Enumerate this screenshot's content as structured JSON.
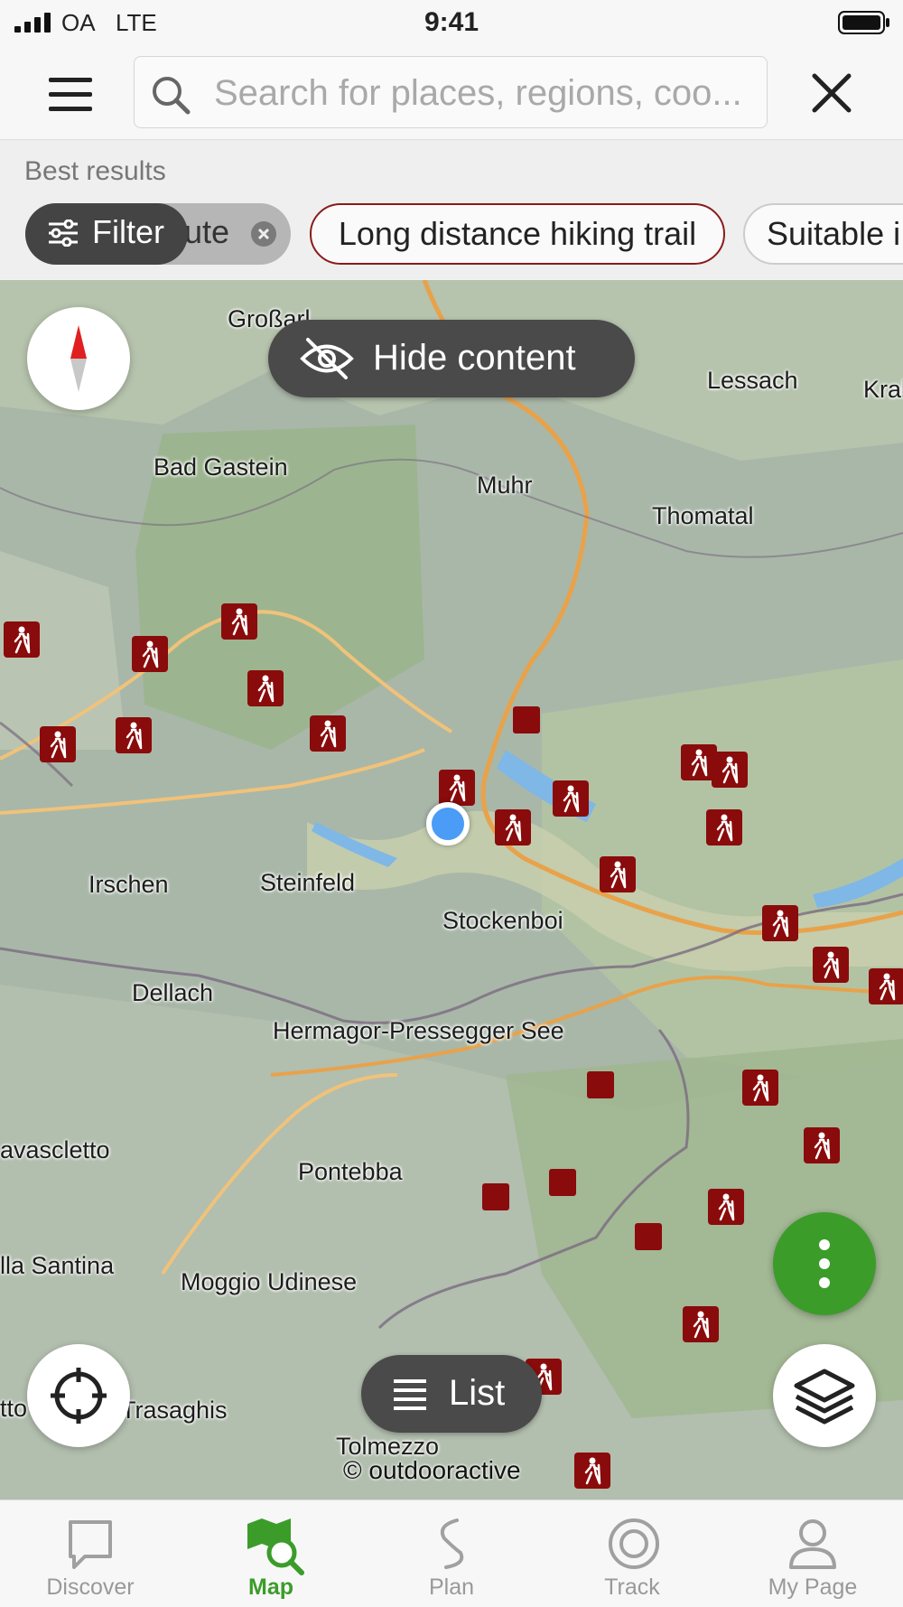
{
  "status_bar": {
    "carrier": "OA",
    "network": "LTE",
    "time": "9:41"
  },
  "search": {
    "placeholder": "Search for places, regions, coo..."
  },
  "results": {
    "title": "Best results",
    "chips": {
      "route_tail": "ute",
      "filter": "Filter",
      "long_distance": "Long distance hiking trail",
      "suitable": "Suitable i"
    }
  },
  "map": {
    "hide_content": "Hide content",
    "list": "List",
    "attribution": "© outdooractive",
    "places": {
      "grossarl": "Großarl",
      "lessach": "Lessach",
      "krak": "Krak",
      "bad_gastein": "Bad Gastein",
      "muhr": "Muhr",
      "thomatal": "Thomatal",
      "irschen": "Irschen",
      "steinfeld": "Steinfeld",
      "stockenboi": "Stockenboi",
      "dellach": "Dellach",
      "hermagor": "Hermagor-Pressegger See",
      "ravascletto": "avascletto",
      "pontebba": "Pontebba",
      "sella_santina": "lla Santina",
      "moggio": "Moggio Udinese",
      "otto": "tto",
      "trasaghis": "Trasaghis",
      "tolmezzo": "Tolmezzo"
    }
  },
  "tabs": {
    "discover": "Discover",
    "map": "Map",
    "plan": "Plan",
    "track": "Track",
    "my_page": "My Page"
  },
  "colors": {
    "accent": "#3b9c2a",
    "marker": "#8a0b0b",
    "chip_border": "#8b1a1a"
  }
}
